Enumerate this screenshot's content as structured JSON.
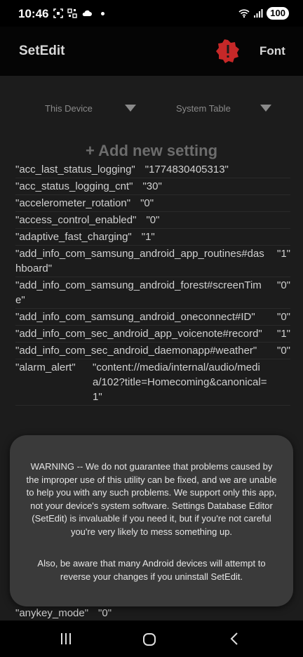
{
  "status_bar": {
    "time": "10:46",
    "battery": "100",
    "left_icons": [
      "screenshot-icon",
      "qr-icon",
      "cloud-icon",
      "dot-icon"
    ],
    "right_icons": [
      "wifi-icon",
      "signal-icon"
    ]
  },
  "app_bar": {
    "title": "SetEdit",
    "warning_icon": "warning-icon",
    "font_label": "Font",
    "accent_color": "#c62828"
  },
  "filters": {
    "device_label": "This Device",
    "table_label": "System Table"
  },
  "add_setting_label": "+ Add new setting",
  "settings": [
    {
      "key": "\"acc_last_status_logging\"",
      "value": "\"1774830405313\""
    },
    {
      "key": "\"acc_status_logging_cnt\"",
      "value": "\"30\""
    },
    {
      "key": "\"accelerometer_rotation\"",
      "value": "\"0\""
    },
    {
      "key": "\"access_control_enabled\"",
      "value": "\"0\""
    },
    {
      "key": "\"adaptive_fast_charging\"",
      "value": "\"1\""
    },
    {
      "key": "\"add_info_com_samsung_android_app_routines#dashboard\"",
      "value": "\"1\""
    },
    {
      "key": "\"add_info_com_samsung_android_forest#screenTime\"",
      "value": "\"0\""
    },
    {
      "key": "\"add_info_com_samsung_android_oneconnect#ID\"",
      "value": "\"0\""
    },
    {
      "key": "\"add_info_com_sec_android_app_voicenote#record\"",
      "value": "\"1\""
    },
    {
      "key": "\"add_info_com_sec_android_daemonapp#weather\"",
      "value": "\"0\""
    },
    {
      "key": "\"alarm_alert\"",
      "value": "\"content://media/internal/audio/media/102?title=Homecoming&canonical=1\""
    }
  ],
  "last_row": {
    "key": "\"anykey_mode\"",
    "value": "\"0\""
  },
  "dialog": {
    "paragraph1": "WARNING -- We do not guarantee that problems caused by the improper use of this utility can be fixed, and we are unable to help you with any such problems. We support only this app, not your device's system software. Settings Database Editor (SetEdit) is invaluable if you need it, but if you're not careful you're very likely to mess something up.",
    "paragraph2": "Also, be aware that many Android devices will attempt to reverse your changes if you uninstall SetEdit."
  },
  "nav_bar": {
    "icons": [
      "recent-apps-icon",
      "home-icon",
      "back-icon"
    ]
  }
}
